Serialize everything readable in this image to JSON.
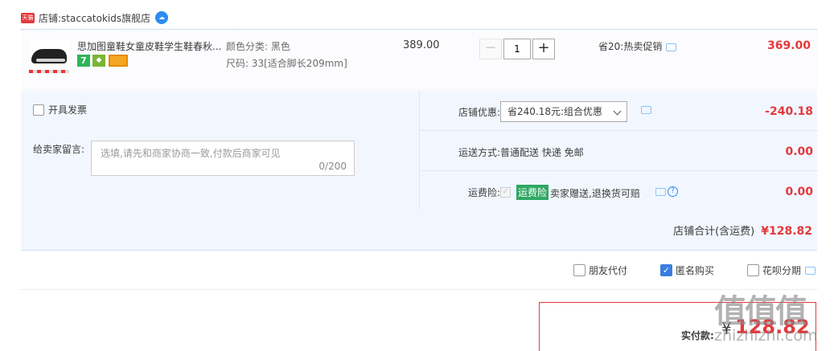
{
  "shop": {
    "badge": "天猫",
    "label": "店铺:",
    "name": "staccatokids旗舰店",
    "ww_icon": "wangwang-icon"
  },
  "item": {
    "title": "思加图童鞋女童皮鞋学生鞋春秋...",
    "badges": {
      "seven": "7"
    },
    "color": "颜色分类: 黑色",
    "size": "尺码: 33[适合脚长209mm]",
    "unit_price": "389.00",
    "quantity": "1",
    "minus": "−",
    "plus": "+",
    "promotion": "省20:热卖促销",
    "total": "369.00"
  },
  "order": {
    "invoice_label": "开具发票",
    "message_label": "给卖家留言:",
    "message_placeholder": "选填,请先和商家协商一致,付款后商家可见",
    "message_count": "0/200",
    "discount": {
      "label": "店铺优惠:",
      "selected": "省240.18元:组合优惠",
      "value": "-240.18"
    },
    "shipping": {
      "label": "运送方式:",
      "text": "普通配送 快递 免邮",
      "value": "0.00"
    },
    "insurance": {
      "label": "运费险:",
      "badge": "运费险",
      "text": "卖家赠送,退换货可赔",
      "value": "0.00",
      "q": "?"
    },
    "shop_total_label": "店铺合计(含运费)",
    "shop_total": "¥128.82"
  },
  "options": {
    "friend_pay": "朋友代付",
    "anonymous": "匿名购买",
    "installment": "花呗分期",
    "anonymous_checked": true
  },
  "payment": {
    "label": "实付款:",
    "symbol": "¥",
    "value": "128.82"
  },
  "watermark": {
    "chars": "值值值",
    "url": "zhizhizhi.com"
  },
  "colors": {
    "accent": "#e4393c",
    "panel": "#f2f7ff",
    "link": "#2d8cf0"
  }
}
